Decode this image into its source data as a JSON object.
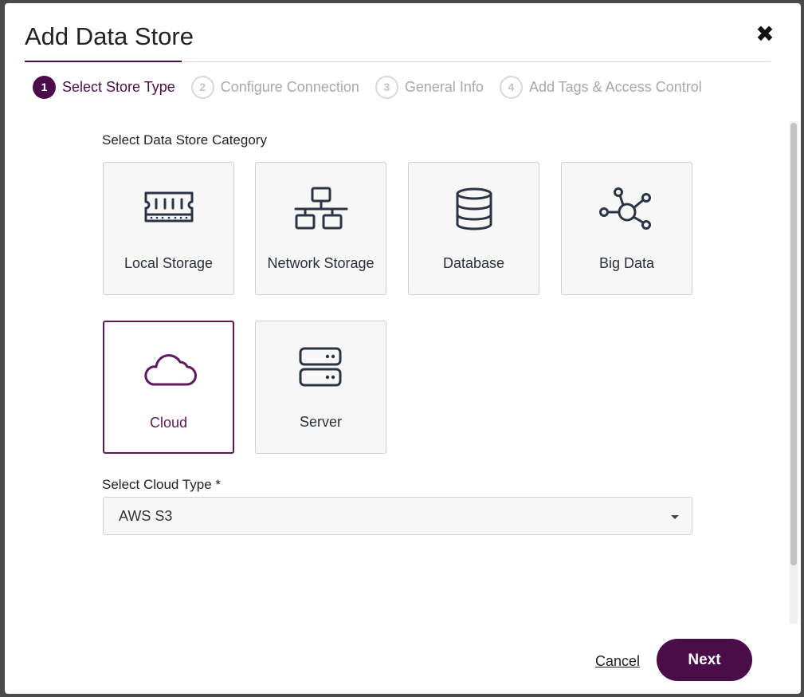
{
  "dialog": {
    "title": "Add Data Store",
    "close_icon": "close-icon"
  },
  "steps": [
    {
      "number": "1",
      "label": "Select Store Type",
      "state": "active"
    },
    {
      "number": "2",
      "label": "Configure Connection",
      "state": "inactive"
    },
    {
      "number": "3",
      "label": "General Info",
      "state": "inactive"
    },
    {
      "number": "4",
      "label": "Add Tags & Access Control",
      "state": "inactive"
    }
  ],
  "category": {
    "label": "Select Data Store Category",
    "tiles": [
      {
        "label": "Local Storage",
        "icon": "memory-chip-icon",
        "selected": false
      },
      {
        "label": "Network Storage",
        "icon": "network-icon",
        "selected": false
      },
      {
        "label": "Database",
        "icon": "database-icon",
        "selected": false
      },
      {
        "label": "Big Data",
        "icon": "hub-nodes-icon",
        "selected": false
      },
      {
        "label": "Cloud",
        "icon": "cloud-icon",
        "selected": true
      },
      {
        "label": "Server",
        "icon": "server-icon",
        "selected": false
      }
    ]
  },
  "cloud_type": {
    "label": "Select Cloud Type *",
    "value": "AWS S3"
  },
  "footer": {
    "cancel_label": "Cancel",
    "next_label": "Next"
  },
  "colors": {
    "accent": "#4a0d4a",
    "selected_tile": "#5c1a5c",
    "icon": "#2b3445"
  }
}
